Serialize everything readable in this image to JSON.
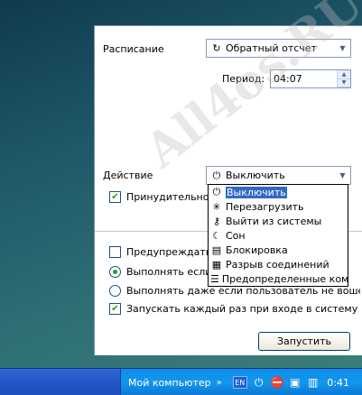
{
  "schedule": {
    "label": "Расписание",
    "value": "Обратный отсчет",
    "icon": "countdown-icon"
  },
  "period": {
    "label": "Период:",
    "value": "04:07"
  },
  "action": {
    "label": "Действие",
    "value": "Выключить",
    "icon": "power-icon",
    "options": [
      {
        "label": "Выключить",
        "icon": "power-icon",
        "glyph": "⏻",
        "selected": true
      },
      {
        "label": "Перезагрузить",
        "icon": "restart-icon",
        "glyph": "✳",
        "selected": false
      },
      {
        "label": "Выйти из системы",
        "icon": "key-icon",
        "glyph": "⚷",
        "selected": false
      },
      {
        "label": "Сон",
        "icon": "moon-icon",
        "glyph": "☾",
        "selected": false
      },
      {
        "label": "Блокировка",
        "icon": "lock-icon",
        "glyph": "▤",
        "selected": false
      },
      {
        "label": "Разрыв соединений",
        "icon": "network-icon",
        "glyph": "▦",
        "selected": false
      },
      {
        "label": "Предопределенные команд",
        "icon": "commands-icon",
        "glyph": "☰",
        "selected": false
      }
    ]
  },
  "force_close": {
    "label": "Принудительно за",
    "checked": true
  },
  "warn": {
    "label": "Предупреждать п",
    "checked": false
  },
  "run_if": {
    "label": "Выполнять если п",
    "selected": true
  },
  "run_even": {
    "label": "Выполнять даже если пользователь не вошел",
    "selected": false
  },
  "run_each_login": {
    "label": "Запускать каждый раз при входе в систему",
    "checked": true
  },
  "start_button": {
    "label": "Запустить"
  },
  "watermark": "All4os.RU",
  "taskbar": {
    "my_computer": "Мой компьютер",
    "chevron": "»",
    "language": "EN",
    "clock": "0:41",
    "tray_icons": [
      "power-icon",
      "no-entry-icon",
      "network-icon",
      "network-icon"
    ]
  },
  "colors": {
    "selection": "#316ac5",
    "check": "#21a121",
    "taskbar": "#2456c7",
    "tray": "#1396ec"
  }
}
